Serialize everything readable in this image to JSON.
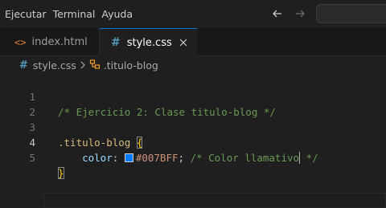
{
  "menubar": {
    "items": [
      "Ejecutar",
      "Terminal",
      "Ayuda"
    ],
    "back_icon": "arrow-left-icon",
    "forward_icon": "arrow-right-icon"
  },
  "tabs": [
    {
      "label": "index.html",
      "icon": "html-file-icon",
      "active": false
    },
    {
      "label": "style.css",
      "icon": "css-file-icon",
      "active": true,
      "close_icon": "close-icon"
    }
  ],
  "breadcrumb": {
    "file": "style.css",
    "symbol": ".titulo-blog",
    "file_icon": "#",
    "symbol_icon": "selector-symbol-icon"
  },
  "editor": {
    "active_line": 4,
    "lines": [
      {
        "number": "1",
        "comment": "/* Ejercicio 2: Clase titulo-blog */"
      },
      {
        "number": "2"
      },
      {
        "number": "3",
        "selector": ".titulo-blog",
        "brace": "{"
      },
      {
        "number": "4",
        "property": "color",
        "colon": ":",
        "value": "#007BFF",
        "semicolon": ";",
        "comment_a": "/* Color llamativo",
        "comment_b": " */"
      },
      {
        "number": "5",
        "brace": "}"
      }
    ],
    "swatch_color": "#007BFF"
  },
  "colors": {
    "background": "#1f1f1f",
    "tab_active_border": "#0078d4",
    "comment": "#6a9955",
    "selector": "#d7ba7d",
    "property": "#9cdcfe",
    "value": "#ce9178",
    "brace": "#ffd700"
  }
}
